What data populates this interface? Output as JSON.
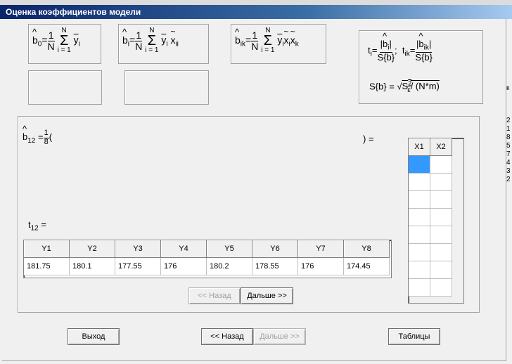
{
  "window": {
    "title": "Оценка коэффициентов модели"
  },
  "formulas": {
    "b0_label": "b",
    "b0_sub": "0",
    "bi_label": "b",
    "bi_sub": "i",
    "bik_label": "b",
    "bik_sub": "ik",
    "one": "1",
    "N": "N",
    "sum_lower": "i = 1",
    "sum_upper": "N",
    "y": "y",
    "y_sub": "i",
    "x": "x",
    "x_sub_ii": "ii",
    "x_sub_i": "i",
    "x_sub_k": "k",
    "t_formula_t": "t",
    "t_formula_i": "i",
    "t_formula_ik": "ik",
    "Sb": "S{b}",
    "sb_formula": "S{b} = ",
    "sb_sqrt": "S",
    "sb_sub": "ε",
    "sb_sup": "2",
    "sb_tail": "/ (N*m)"
  },
  "calc": {
    "b12_label": "b",
    "b12_sub": "12",
    "eq": "=",
    "frac_num": "1",
    "frac_den": "8",
    "open": "(",
    "close": ") =",
    "t12_label": "t",
    "t12_sub": "12",
    "t12_eq": "="
  },
  "y_table": {
    "headers": [
      "Y1",
      "Y2",
      "Y3",
      "Y4",
      "Y5",
      "Y6",
      "Y7",
      "Y8"
    ],
    "values": [
      "181.75",
      "180.1",
      "177.55",
      "176",
      "180.2",
      "178.55",
      "176",
      "174.45"
    ]
  },
  "x_table": {
    "headers": [
      "X1",
      "X2"
    ]
  },
  "panel_buttons": {
    "back": "<< Назад",
    "next": "Дальше >>"
  },
  "bottom_buttons": {
    "exit": "Выход",
    "back": "<< Назад",
    "next": "Дальше >>",
    "tables": "Таблицы"
  },
  "edge_text": [
    "к",
    "2",
    "1",
    "8",
    "5",
    "7",
    "4",
    "3",
    "2"
  ]
}
